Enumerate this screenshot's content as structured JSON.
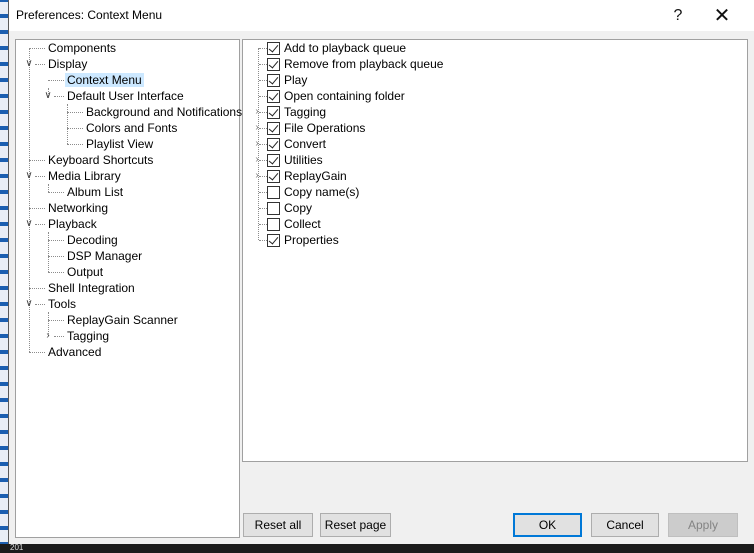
{
  "window": {
    "title": "Preferences: Context Menu",
    "help_label": "?",
    "close_label": "✕"
  },
  "tree": {
    "items": [
      {
        "label": "Components"
      },
      {
        "label": "Display",
        "expanded": true
      },
      {
        "label": "Context Menu",
        "selected": true
      },
      {
        "label": "Default User Interface",
        "expanded": true
      },
      {
        "label": "Background and Notifications"
      },
      {
        "label": "Colors and Fonts"
      },
      {
        "label": "Playlist View"
      },
      {
        "label": "Keyboard Shortcuts"
      },
      {
        "label": "Media Library",
        "expanded": true
      },
      {
        "label": "Album List"
      },
      {
        "label": "Networking"
      },
      {
        "label": "Playback",
        "expanded": true
      },
      {
        "label": "Decoding"
      },
      {
        "label": "DSP Manager"
      },
      {
        "label": "Output"
      },
      {
        "label": "Shell Integration"
      },
      {
        "label": "Tools",
        "expanded": true
      },
      {
        "label": "ReplayGain Scanner"
      },
      {
        "label": "Tagging",
        "expanded": false
      },
      {
        "label": "Advanced"
      }
    ]
  },
  "context_items": [
    {
      "label": "Add to playback queue",
      "checked": true,
      "has_children": false
    },
    {
      "label": "Remove from playback queue",
      "checked": true,
      "has_children": false
    },
    {
      "label": "Play",
      "checked": true,
      "has_children": false
    },
    {
      "label": "Open containing folder",
      "checked": true,
      "has_children": false
    },
    {
      "label": "Tagging",
      "checked": true,
      "has_children": true
    },
    {
      "label": "File Operations",
      "checked": true,
      "has_children": true
    },
    {
      "label": "Convert",
      "checked": true,
      "has_children": true
    },
    {
      "label": "Utilities",
      "checked": true,
      "has_children": true
    },
    {
      "label": "ReplayGain",
      "checked": true,
      "has_children": true
    },
    {
      "label": "Copy name(s)",
      "checked": false,
      "has_children": false
    },
    {
      "label": "Copy",
      "checked": false,
      "has_children": false
    },
    {
      "label": "Collect",
      "checked": false,
      "has_children": false
    },
    {
      "label": "Properties",
      "checked": true,
      "has_children": false
    }
  ],
  "buttons": {
    "reset_all": "Reset all",
    "reset_page": "Reset page",
    "ok": "OK",
    "cancel": "Cancel",
    "apply": "Apply"
  },
  "background": {
    "strip_text": "201"
  },
  "colors": {
    "selection": "#cce8ff",
    "default_button_border": "#0078d7",
    "taskbar_strip": "#1c5fb0"
  }
}
